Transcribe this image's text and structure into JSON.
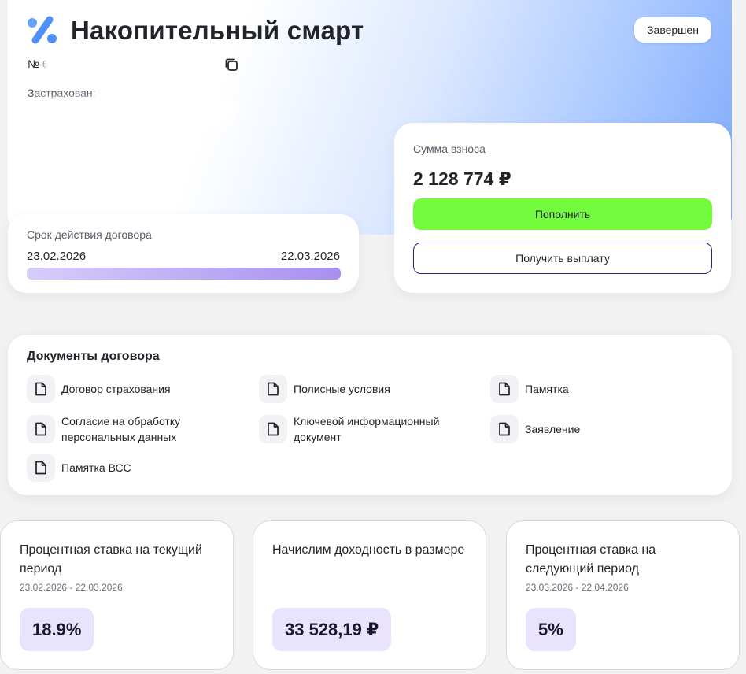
{
  "header": {
    "title": "Накопительный смарт",
    "status": "Завершен",
    "policy_number": "№ 6",
    "insured_label": "Застрахован:"
  },
  "term": {
    "label": "Срок действия договора",
    "start_date": "23.02.2026",
    "end_date": "22.03.2026",
    "progress_fraction": 1.0
  },
  "payment": {
    "label": "Сумма взноса",
    "amount": "2 128 774 ₽",
    "topup_label": "Пополнить",
    "payout_label": "Получить выплату"
  },
  "documents": {
    "title": "Документы договора",
    "items": [
      {
        "label": "Договор страхования",
        "icon": "document-icon"
      },
      {
        "label": "Полисные условия",
        "icon": "document-icon"
      },
      {
        "label": "Памятка",
        "icon": "document-icon"
      },
      {
        "label": "Согласие на обработку персональных данных",
        "icon": "document-icon"
      },
      {
        "label": "Ключевой информационный документ",
        "icon": "document-icon"
      },
      {
        "label": "Заявление",
        "icon": "document-icon"
      },
      {
        "label": "Памятка ВСС",
        "icon": "document-icon"
      }
    ]
  },
  "rates": [
    {
      "title": "Процентная ставка на текущий период",
      "period": "23.02.2026 - 22.03.2026",
      "value": "18.9%"
    },
    {
      "title": "Начислим доходность в размере",
      "period": "",
      "value": "33 528,19 ₽"
    },
    {
      "title": "Процентная ставка на следующий период",
      "period": "23.03.2026 - 22.04.2026",
      "value": "5%"
    }
  ],
  "colors": {
    "accent_green": "#73fb3d",
    "accent_purple": "#a88ff0",
    "badge_bg": "#e9e3fd",
    "logo_blue": "#4f8ff7"
  }
}
